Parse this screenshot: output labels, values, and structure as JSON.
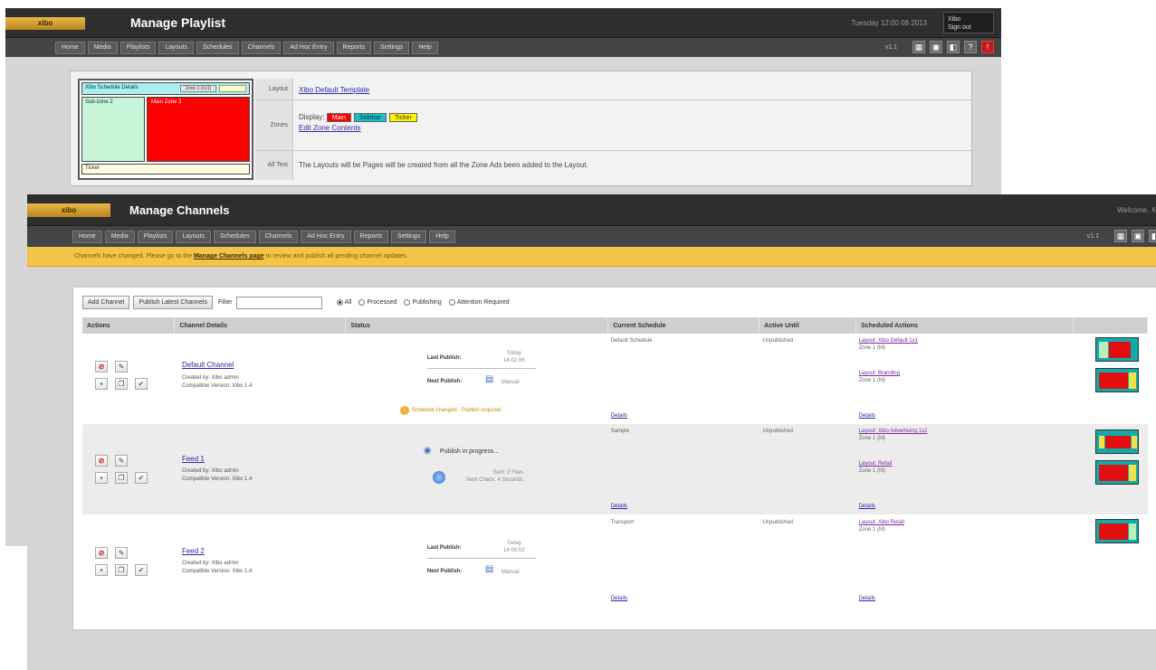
{
  "back_window": {
    "logo": "xibo",
    "title": "Manage Playlist",
    "top_right_text": "Tuesday 12:00 08 2013",
    "user_line1": "Xibo",
    "user_line2": "Sign out",
    "nav": [
      "Home",
      "Media",
      "Playlists",
      "Layouts",
      "Schedules",
      "Channels",
      "Ad Hoc Entry",
      "Reports",
      "Settings",
      "Help"
    ],
    "version": "v1.1",
    "layout_preview": {
      "top_label": "Xibo Schedule Details",
      "top_tag": "Zone 1 (1x1)",
      "left_label": "Sub-zone 2",
      "right_label": "Main Zone 3",
      "bottom_label": "Ticker"
    },
    "rows": {
      "layout_label": "Layout",
      "layout_value": "Xibo Default Template",
      "zones_label": "Zones",
      "zones_prefix": "Display:",
      "zones": [
        {
          "name": "Main",
          "color": "#ff0000",
          "text": "#ffffff"
        },
        {
          "name": "Sidebar",
          "color": "#19c0c4",
          "text": "#063b3b"
        },
        {
          "name": "Ticker",
          "color": "#fff200",
          "text": "#333333"
        }
      ],
      "zones_link": "Edit Zone Contents",
      "info_label": "All Text",
      "info_value": "The Layouts will be Pages will be created from all the Zone Ads been added to the Layout."
    }
  },
  "front_window": {
    "logo": "xibo",
    "title": "Manage Channels",
    "welcome": "Welcome, X",
    "nav": [
      "Home",
      "Media",
      "Playlists",
      "Layouts",
      "Schedules",
      "Channels",
      "Ad Hoc Entry",
      "Reports",
      "Settings",
      "Help"
    ],
    "version": "v1.1",
    "notice_prefix": "Channels have changed. Please go to the",
    "notice_link": "Manage Channels page",
    "notice_suffix": "to review and publish all pending channel updates.",
    "toolbar": {
      "add_label": "Add Channel",
      "publish_label": "Publish Latest Channels",
      "filter_label": "Filter",
      "filter_value": "",
      "radios": [
        {
          "label": "All",
          "checked": true
        },
        {
          "label": "Processed",
          "checked": false
        },
        {
          "label": "Publishing",
          "checked": false
        },
        {
          "label": "Attention Required",
          "checked": false
        }
      ]
    },
    "columns": [
      "Actions",
      "Channel Details",
      "Status",
      "Current Schedule",
      "Active Until",
      "Scheduled Actions",
      ""
    ],
    "rows": [
      {
        "name": "Default Channel",
        "meta1": "Created by: Xibo admin",
        "meta2": "Compatible Version: Xibo 1.4",
        "last_label": "Last Publish:",
        "last_value": "Today 14:02:06",
        "next_label": "Next Publish:",
        "next_value": "Manual",
        "warning": "Schedule changed - Publish required",
        "schedule": "Default Schedule",
        "active": "Unpublished",
        "sched1": "Layout: Xibo Default 1x1",
        "sched1_sub": "Zone 1 (M)",
        "sched2": "Layout: Branding",
        "sched2_sub": "Zone 1 (M)",
        "details": "Details"
      },
      {
        "name": "Feed 1",
        "meta1": "Created by: Xibo admin",
        "meta2": "Compatible Version: Xibo 1.4",
        "sync_text": "Publish in progress...",
        "sync_sub1": "Sent: 2 Files",
        "sync_sub2": "Next Check: 4 Seconds",
        "schedule": "Sample",
        "active": "Unpublished",
        "sched1": "Layout: Xibo Advertising 1x2",
        "sched1_sub": "Zone 1 (M)",
        "sched2": "Layout: Retail",
        "sched2_sub": "Zone 1 (M)",
        "details": "Details"
      },
      {
        "name": "Feed 2",
        "meta1": "Created by: Xibo admin",
        "meta2": "Compatible Version: Xibo 1.4",
        "last_label": "Last Publish:",
        "last_value": "Today 14:00:02",
        "next_label": "Next Publish:",
        "next_value": "Manual",
        "schedule": "Transport",
        "active": "Unpublished",
        "sched1": "Layout: Xibo Retail",
        "sched1_sub": "Zone 1 (M)",
        "details": "Details"
      }
    ]
  }
}
